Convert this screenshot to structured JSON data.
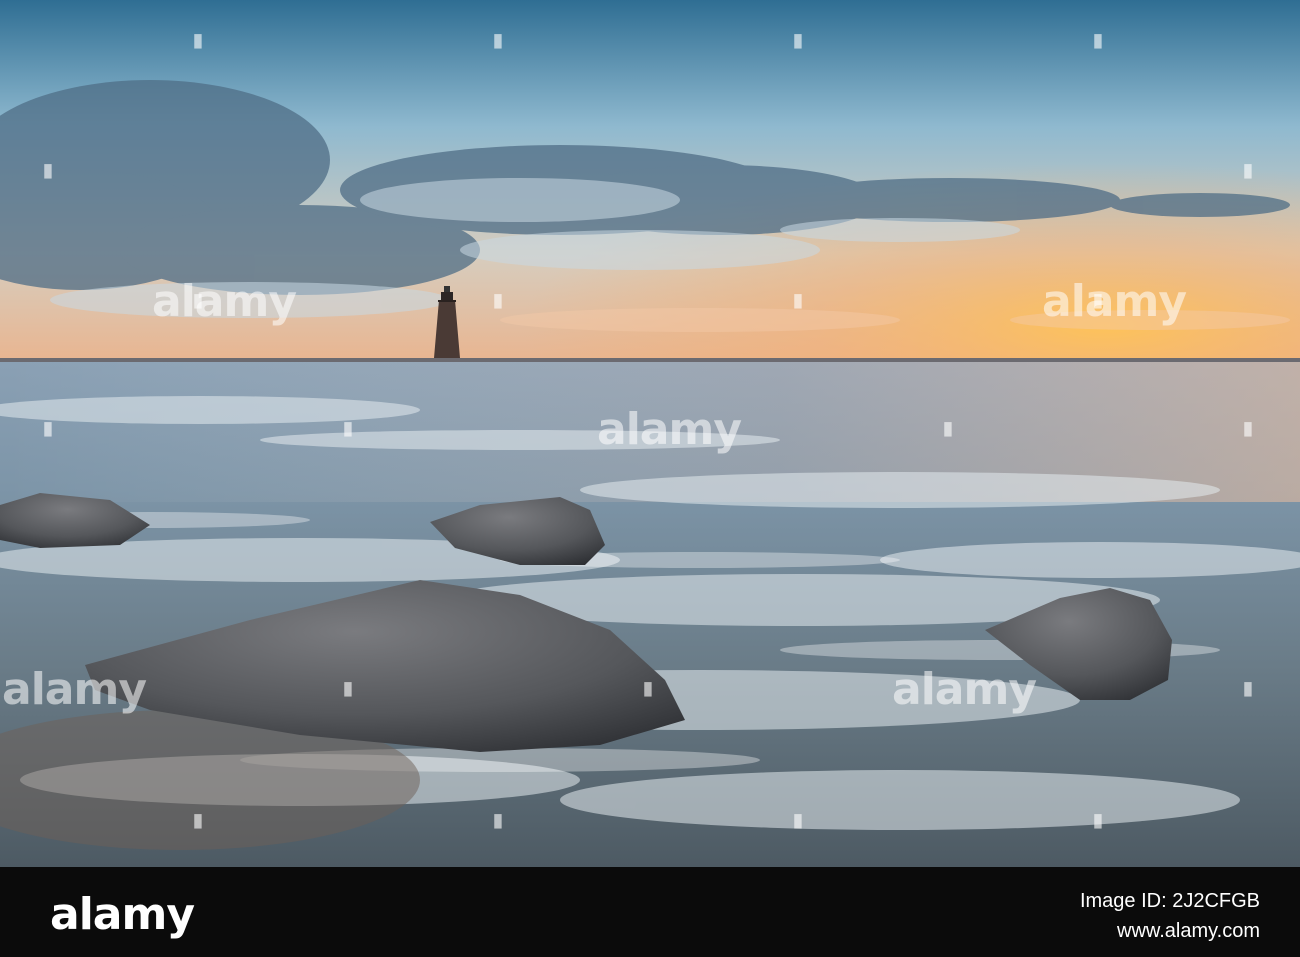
{
  "image": {
    "subject": "lighthouse-seascape-sunset",
    "colors": {
      "sky_top": "#3d7ba0",
      "sky_mid": "#9cc3d6",
      "sky_horizon": "#f4b860",
      "sea": "#6f8797",
      "foam": "#dfe7ec",
      "rock": "#595b5e",
      "lighthouse": "#4a3a35"
    }
  },
  "watermark": {
    "text": "alamy",
    "icon": "alamy-dot-icon"
  },
  "footer": {
    "logo": "alamy",
    "image_id": "Image ID: 2J2CFGB",
    "site": "www.alamy.com"
  }
}
